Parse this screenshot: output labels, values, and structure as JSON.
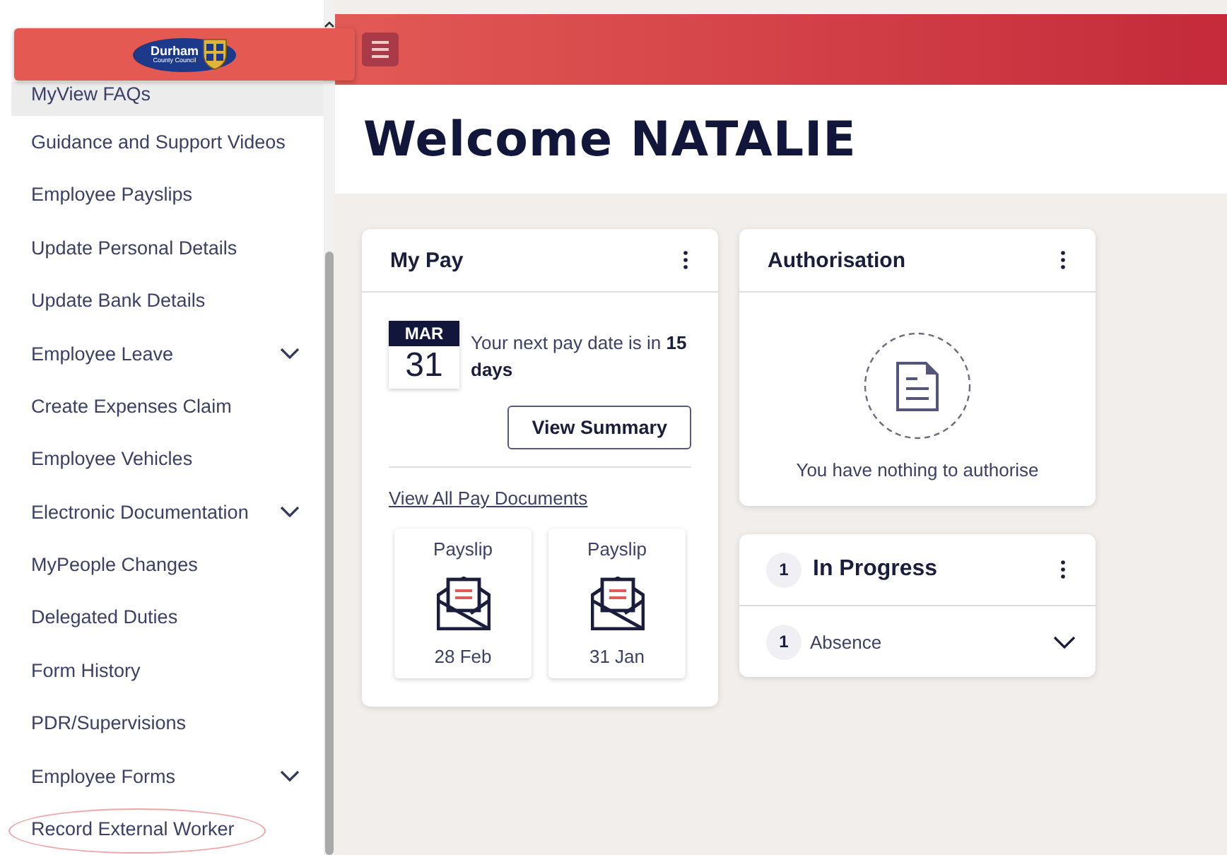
{
  "logo": {
    "line1": "Durham",
    "line2": "County Council"
  },
  "sidebar": {
    "items": [
      {
        "label": "MyView FAQs",
        "expandable": false,
        "hovered": true,
        "circled": false
      },
      {
        "label": "Guidance and Support Videos",
        "expandable": false,
        "hovered": false,
        "circled": false
      },
      {
        "label": "Employee Payslips",
        "expandable": false,
        "hovered": false,
        "circled": false
      },
      {
        "label": "Update Personal Details",
        "expandable": false,
        "hovered": false,
        "circled": false
      },
      {
        "label": "Update Bank Details",
        "expandable": false,
        "hovered": false,
        "circled": false
      },
      {
        "label": "Employee Leave",
        "expandable": true,
        "hovered": false,
        "circled": false
      },
      {
        "label": "Create Expenses Claim",
        "expandable": false,
        "hovered": false,
        "circled": false
      },
      {
        "label": "Employee Vehicles",
        "expandable": false,
        "hovered": false,
        "circled": false
      },
      {
        "label": "Electronic Documentation",
        "expandable": true,
        "hovered": false,
        "circled": false
      },
      {
        "label": "MyPeople Changes",
        "expandable": false,
        "hovered": false,
        "circled": false
      },
      {
        "label": "Delegated Duties",
        "expandable": false,
        "hovered": false,
        "circled": false
      },
      {
        "label": "Form History",
        "expandable": false,
        "hovered": false,
        "circled": false
      },
      {
        "label": "PDR/Supervisions",
        "expandable": false,
        "hovered": false,
        "circled": false
      },
      {
        "label": "Employee Forms",
        "expandable": true,
        "hovered": false,
        "circled": false
      },
      {
        "label": "Record External Worker",
        "expandable": false,
        "hovered": false,
        "circled": true
      }
    ]
  },
  "welcome": "Welcome NATALIE",
  "my_pay": {
    "title": "My Pay",
    "month": "MAR",
    "day": "31",
    "message": "Your next pay date is in **15 days**",
    "button": "View Summary",
    "link": "View All Pay Documents",
    "payslips": [
      {
        "label": "Payslip",
        "date": "28 Feb"
      },
      {
        "label": "Payslip",
        "date": "31 Jan"
      }
    ]
  },
  "authorisation": {
    "title": "Authorisation",
    "empty_message": "You have nothing to authorise"
  },
  "in_progress": {
    "count": "1",
    "title": "In Progress",
    "items": [
      {
        "count": "1",
        "label": "Absence",
        "expanded": false
      }
    ]
  }
}
